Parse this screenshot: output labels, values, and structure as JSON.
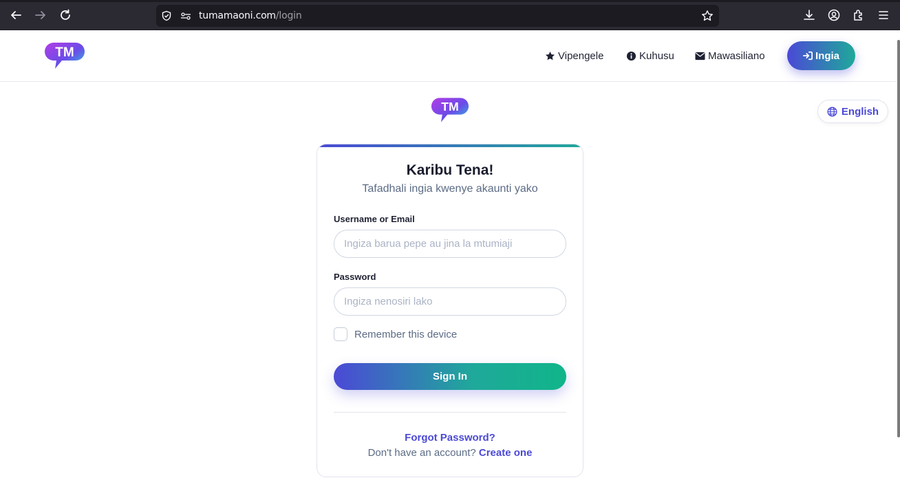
{
  "browser": {
    "url_host": "tumamaoni.com",
    "url_path": "/login"
  },
  "header": {
    "nav": [
      {
        "label": "Vipengele",
        "icon": "star-icon"
      },
      {
        "label": "Kuhusu",
        "icon": "info-icon"
      },
      {
        "label": "Mawasiliano",
        "icon": "envelope-icon"
      }
    ],
    "login_label": "Ingia",
    "logo_text": "TM"
  },
  "language": {
    "label": "English"
  },
  "login_card": {
    "title": "Karibu Tena!",
    "subtitle": "Tafadhali ingia kwenye akaunti yako",
    "username_label": "Username or Email",
    "username_placeholder": "Ingiza barua pepe au jina la mtumiaji",
    "username_value": "",
    "password_label": "Password",
    "password_placeholder": "Ingiza nenosiri lako",
    "password_value": "",
    "remember_label": "Remember this device",
    "remember_checked": false,
    "submit_label": "Sign In",
    "forgot_label": "Forgot Password?",
    "signup_prompt": "Don't have an account?",
    "signup_link": "Create one"
  },
  "colors": {
    "brand_primary": "#4b49d6",
    "brand_secondary": "#1fa99a"
  }
}
